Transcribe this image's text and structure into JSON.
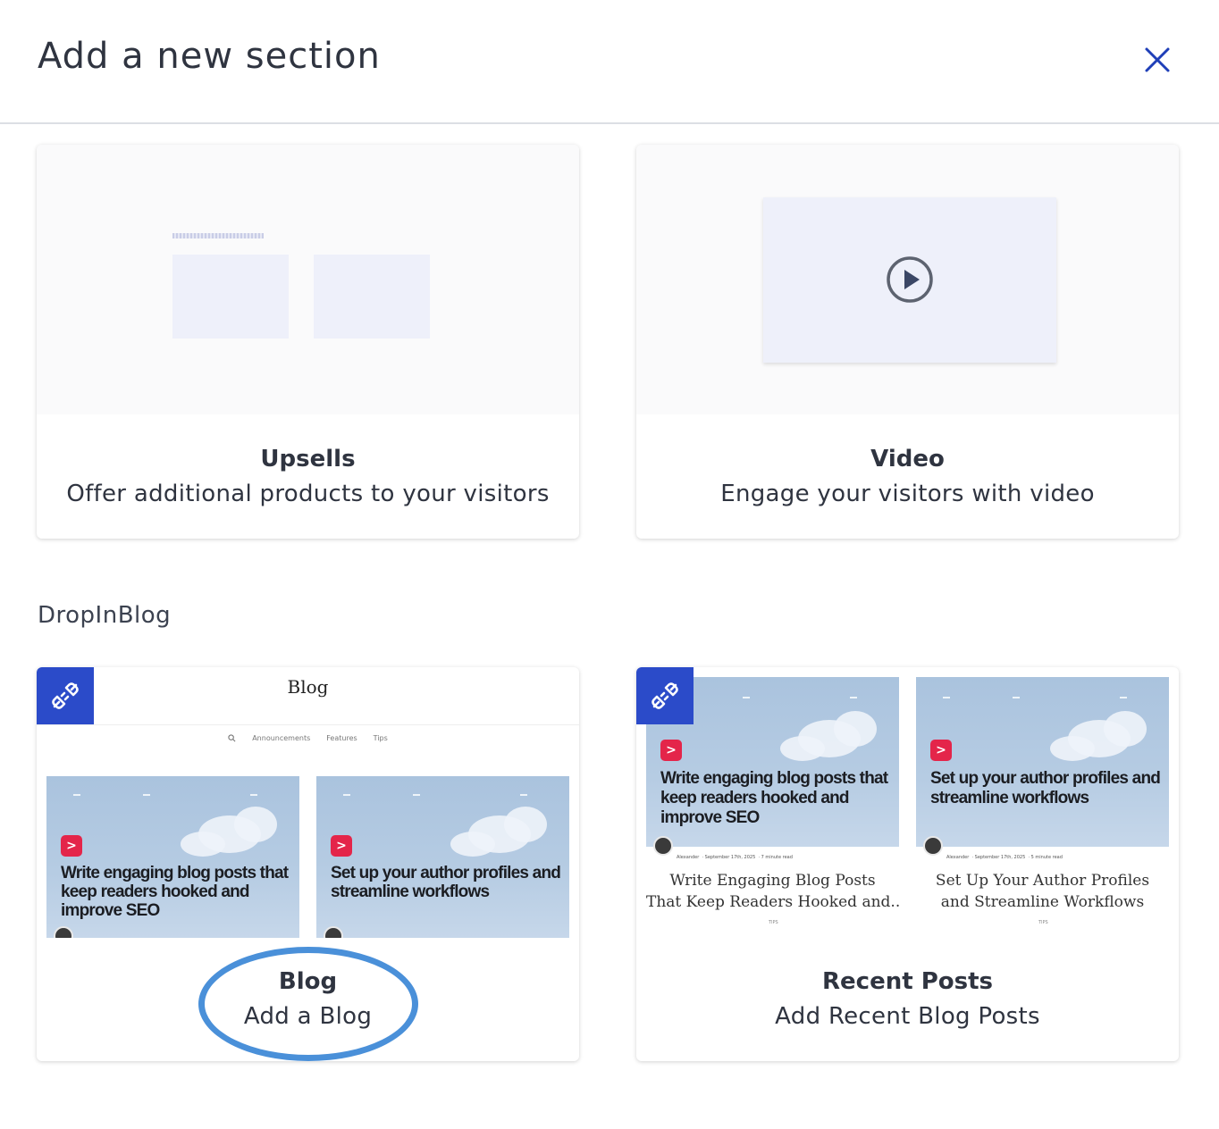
{
  "header": {
    "title": "Add a new section",
    "close_label": "×"
  },
  "cards": {
    "upsells": {
      "title": "Upsells",
      "description": "Offer additional products to your visitors"
    },
    "video": {
      "title": "Video",
      "description": "Engage your visitors with video"
    },
    "blog": {
      "title": "Blog",
      "description": "Add a Blog",
      "preview": {
        "header": "Blog",
        "nav": [
          "Announcements",
          "Features",
          "Tips"
        ],
        "posts": [
          {
            "headline": "Write engaging blog posts that keep readers hooked and improve SEO"
          },
          {
            "headline": "Set up your author profiles and streamline workflows"
          }
        ]
      }
    },
    "recent_posts": {
      "title": "Recent Posts",
      "description": "Add Recent Blog Posts",
      "preview": {
        "posts": [
          {
            "headline": "Write engaging blog posts that keep readers hooked and improve SEO",
            "meta_author": "Alexander",
            "meta_date": "September 17th, 2025",
            "meta_read": "7 minute read",
            "serif_title_line1": "Write Engaging Blog Posts",
            "serif_title_line2": "That Keep Readers Hooked and..",
            "tag": "TIPS"
          },
          {
            "headline": "Set up your author profiles and streamline workflows",
            "meta_author": "Alexander",
            "meta_date": "September 17th, 2025",
            "meta_read": "5 minute read",
            "serif_title_line1": "Set Up Your Author Profiles",
            "serif_title_line2": "and Streamline Workflows",
            "tag": "TIPS"
          }
        ]
      }
    }
  },
  "section_label": "DropInBlog",
  "icons": {
    "close": "close-icon",
    "play": "play-icon",
    "plugin": "plug-icon",
    "search": "search-icon"
  },
  "colors": {
    "accent": "#2b4bc9",
    "close_icon": "#1f3fb8",
    "highlight": "#4a90d9",
    "post_logo": "#e4254a"
  }
}
